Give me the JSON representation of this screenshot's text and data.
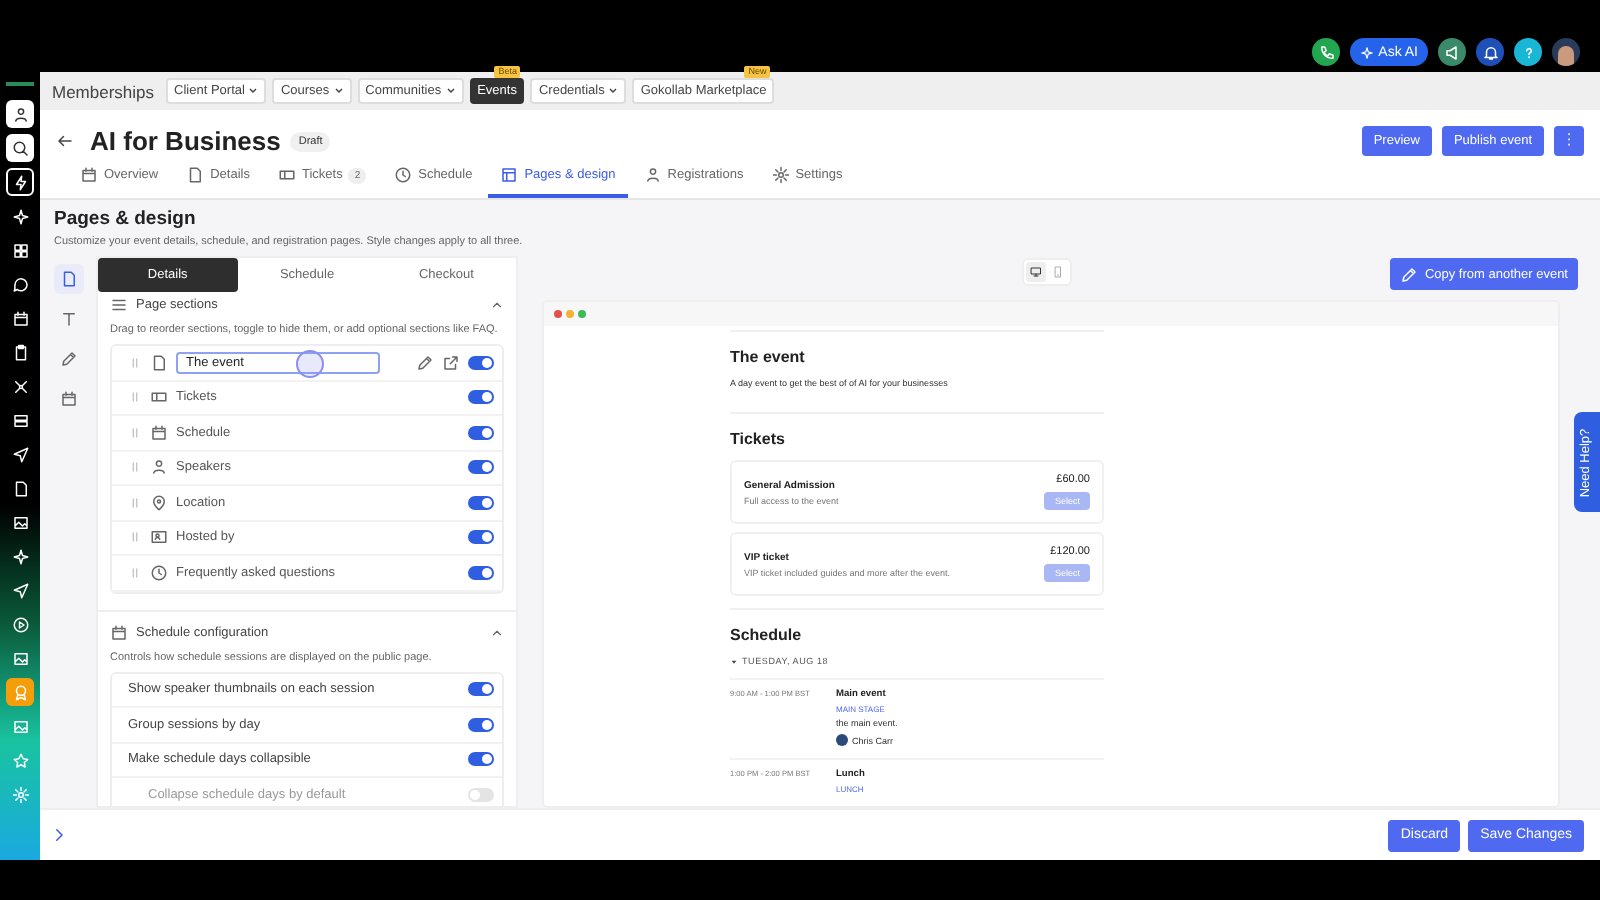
{
  "top_bar": {
    "ask_ai": "Ask AI"
  },
  "nav": {
    "title": "Memberships",
    "items": [
      {
        "label": "Client Portal",
        "dropdown": true,
        "selected": false
      },
      {
        "label": "Courses",
        "dropdown": true,
        "selected": false
      },
      {
        "label": "Communities",
        "dropdown": true,
        "selected": false
      },
      {
        "label": "Events",
        "dropdown": false,
        "selected": true,
        "badge": "Beta"
      },
      {
        "label": "Credentials",
        "dropdown": true,
        "selected": false
      },
      {
        "label": "Gokollab Marketplace",
        "dropdown": false,
        "selected": false,
        "badge": "New"
      }
    ]
  },
  "header": {
    "title": "AI for Business",
    "status": "Draft",
    "buttons": [
      "Preview",
      "Publish event"
    ]
  },
  "tabs": [
    {
      "label": "Overview",
      "selected": false
    },
    {
      "label": "Details",
      "selected": false
    },
    {
      "label": "Tickets",
      "count": "2",
      "selected": false
    },
    {
      "label": "Schedule",
      "selected": false
    },
    {
      "label": "Pages & design",
      "selected": true
    },
    {
      "label": "Registrations",
      "selected": false
    },
    {
      "label": "Settings",
      "selected": false
    }
  ],
  "page": {
    "title": "Pages & design",
    "subtitle": "Customize your event details, schedule, and registration pages. Style changes apply to all three."
  },
  "editor_tabs": [
    {
      "label": "Details",
      "selected": true
    },
    {
      "label": "Schedule",
      "selected": false
    },
    {
      "label": "Checkout",
      "selected": false
    }
  ],
  "page_sections": {
    "title": "Page sections",
    "expanded": true,
    "description": "Drag to reorder sections, toggle to hide them, or add optional sections like FAQ.",
    "items": [
      {
        "label": "The event",
        "editing": true,
        "enabled": true
      },
      {
        "label": "Tickets",
        "editing": false,
        "enabled": true
      },
      {
        "label": "Schedule",
        "editing": false,
        "enabled": true
      },
      {
        "label": "Speakers",
        "editing": false,
        "enabled": true
      },
      {
        "label": "Location",
        "editing": false,
        "enabled": true
      },
      {
        "label": "Hosted by",
        "editing": false,
        "enabled": true
      },
      {
        "label": "Frequently asked questions",
        "editing": false,
        "enabled": true
      }
    ]
  },
  "schedule_config": {
    "title": "Schedule configuration",
    "expanded": true,
    "description": "Controls how schedule sessions are displayed on the public page.",
    "options": [
      {
        "label": "Show speaker thumbnails on each session",
        "on": true,
        "indented": false
      },
      {
        "label": "Group sessions by day",
        "on": true,
        "indented": false
      },
      {
        "label": "Make schedule days collapsible",
        "on": true,
        "indented": false
      },
      {
        "label": "Collapse schedule days by default",
        "on": false,
        "indented": true
      }
    ]
  },
  "preview": {
    "copy_button": "Copy from another event",
    "devices": [
      {
        "selected": true
      },
      {
        "selected": false
      }
    ],
    "event": {
      "heading": "The event",
      "text": "A day event to get the best of of AI for your businesses"
    },
    "tickets": {
      "heading": "Tickets",
      "items": [
        {
          "name": "General Admission",
          "description": "Full access to the event",
          "price": "£60.00",
          "button": "Select"
        },
        {
          "name": "VIP ticket",
          "description": "VIP ticket included guides and more after the event.",
          "price": "£120.00",
          "button": "Select"
        }
      ]
    },
    "schedule": {
      "heading": "Schedule",
      "day": "TUESDAY, AUG 18",
      "expanded": true,
      "sessions": [
        {
          "time": "9:00 AM - 1:00 PM BST",
          "title": "Main event",
          "track": "MAIN STAGE",
          "description": "the main event.",
          "speaker": "Chris Carr"
        },
        {
          "time": "1:00 PM - 2:00 PM BST",
          "title": "Lunch",
          "track": "LUNCH"
        }
      ]
    }
  },
  "footer": {
    "buttons": [
      "Discard",
      "Save Changes"
    ]
  },
  "help_tab": "Need Help?"
}
